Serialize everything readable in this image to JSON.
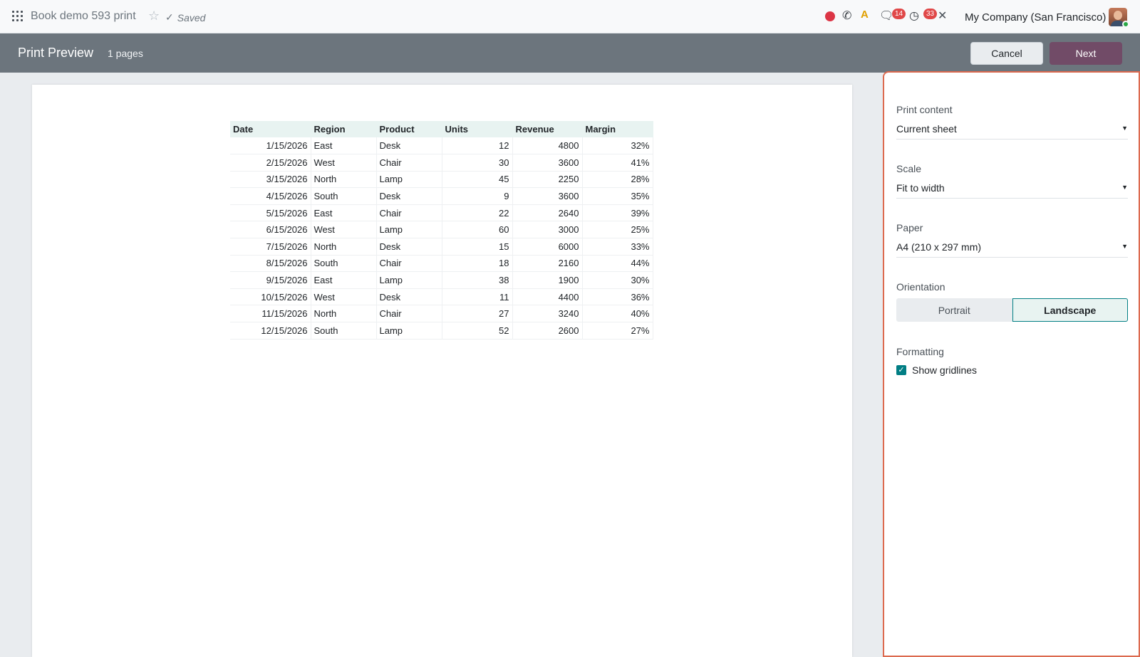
{
  "topbar": {
    "doc_title": "Book demo 593 print",
    "saved": "Saved",
    "badges": {
      "messages": "14",
      "activities": "33"
    },
    "company": "My Company (San Francisco)"
  },
  "control": {
    "title": "Print Preview",
    "pages": "1 pages",
    "cancel": "Cancel",
    "next": "Next"
  },
  "sheet": {
    "headers": [
      "Date",
      "Region",
      "Product",
      "Units",
      "Revenue",
      "Margin"
    ],
    "rows": [
      [
        "1/15/2026",
        "East",
        "Desk",
        "12",
        "4800",
        "32%"
      ],
      [
        "2/15/2026",
        "West",
        "Chair",
        "30",
        "3600",
        "41%"
      ],
      [
        "3/15/2026",
        "North",
        "Lamp",
        "45",
        "2250",
        "28%"
      ],
      [
        "4/15/2026",
        "South",
        "Desk",
        "9",
        "3600",
        "35%"
      ],
      [
        "5/15/2026",
        "East",
        "Chair",
        "22",
        "2640",
        "39%"
      ],
      [
        "6/15/2026",
        "West",
        "Lamp",
        "60",
        "3000",
        "25%"
      ],
      [
        "7/15/2026",
        "North",
        "Desk",
        "15",
        "6000",
        "33%"
      ],
      [
        "8/15/2026",
        "South",
        "Chair",
        "18",
        "2160",
        "44%"
      ],
      [
        "9/15/2026",
        "East",
        "Lamp",
        "38",
        "1900",
        "30%"
      ],
      [
        "10/15/2026",
        "West",
        "Desk",
        "11",
        "4400",
        "36%"
      ],
      [
        "11/15/2026",
        "North",
        "Chair",
        "27",
        "3240",
        "40%"
      ],
      [
        "12/15/2026",
        "South",
        "Lamp",
        "52",
        "2600",
        "27%"
      ]
    ]
  },
  "panel": {
    "print_content": {
      "label": "Print content",
      "value": "Current sheet"
    },
    "scale": {
      "label": "Scale",
      "value": "Fit to width"
    },
    "paper": {
      "label": "Paper",
      "value": "A4 (210 x 297 mm)"
    },
    "orientation": {
      "label": "Orientation",
      "portrait": "Portrait",
      "landscape": "Landscape",
      "selected": "Landscape"
    },
    "formatting": {
      "label": "Formatting",
      "show_gridlines": "Show gridlines",
      "show_gridlines_checked": true
    }
  },
  "colors": {
    "brand": "#714b67",
    "accent": "#017e84",
    "highlight_border": "#dc6a4f",
    "badge": "#e04848"
  }
}
